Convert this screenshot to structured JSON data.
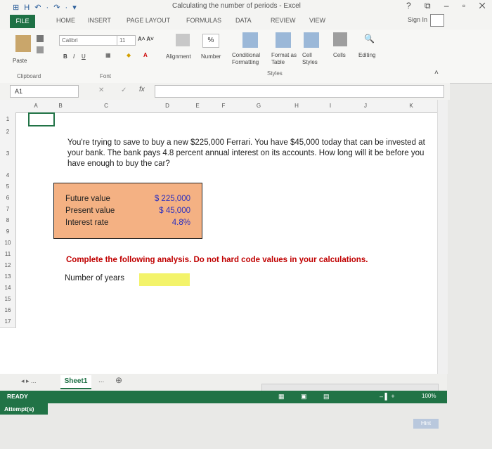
{
  "window": {
    "title": "Calculating the number of periods - Excel",
    "controls": "? ⧉ – ▫ ✕"
  },
  "qat": "⊞ H ↶ · ↷ · ▾",
  "tabs": [
    "FILE",
    "HOME",
    "INSERT",
    "PAGE LAYOUT",
    "FORMULAS",
    "DATA",
    "REVIEW",
    "VIEW"
  ],
  "sign_in": "Sign In",
  "ribbon": {
    "paste": "Paste",
    "clipboard": "Clipboard",
    "font_name": "Calibri",
    "font_size": "11",
    "font_group": "Font",
    "bold": "B",
    "italic": "I",
    "underline": "U",
    "alignment": "Alignment",
    "number": "Number",
    "percent": "%",
    "conditional_formatting": "Conditional Formatting",
    "format_as_table": "Format as Table",
    "cell_styles": "Cell Styles",
    "styles_group": "Styles",
    "cells": "Cells",
    "editing": "Editing"
  },
  "formula_bar": {
    "name_box": "A1",
    "fx": "fx",
    "content": ""
  },
  "columns": [
    "A",
    "B",
    "C",
    "D",
    "E",
    "F",
    "G",
    "H",
    "I",
    "J",
    "K"
  ],
  "rows": [
    "1",
    "2",
    "3",
    "4",
    "5",
    "6",
    "7",
    "8",
    "9",
    "10",
    "11",
    "12",
    "13",
    "14",
    "15",
    "16",
    "17"
  ],
  "problem_text": "You're trying to save to buy a new $225,000 Ferrari. You have $45,000 today that can be invested at your bank. The bank pays 4.8 percent annual interest on its accounts. How long will it be before you have enough to buy the car?",
  "inputs": [
    {
      "label": "Future value",
      "value": "$ 225,000"
    },
    {
      "label": "Present value",
      "value": "$ 45,000"
    },
    {
      "label": "Interest rate",
      "value": "4.8%"
    }
  ],
  "instruction": "Complete the following analysis. Do not hard code values in your calculations.",
  "number_of_years_label": "Number of years",
  "number_of_years_value": "",
  "sheet_tab": "Sheet1",
  "status": {
    "ready": "READY",
    "zoom": "100%",
    "attempts": "Attempt(s)",
    "hint": "Hint"
  },
  "colors": {
    "excel_green": "#217346",
    "input_box": "#f4b183",
    "answer_cell": "#f3f36a",
    "instruction": "#c00000",
    "value_text": "#2b2fbf"
  }
}
